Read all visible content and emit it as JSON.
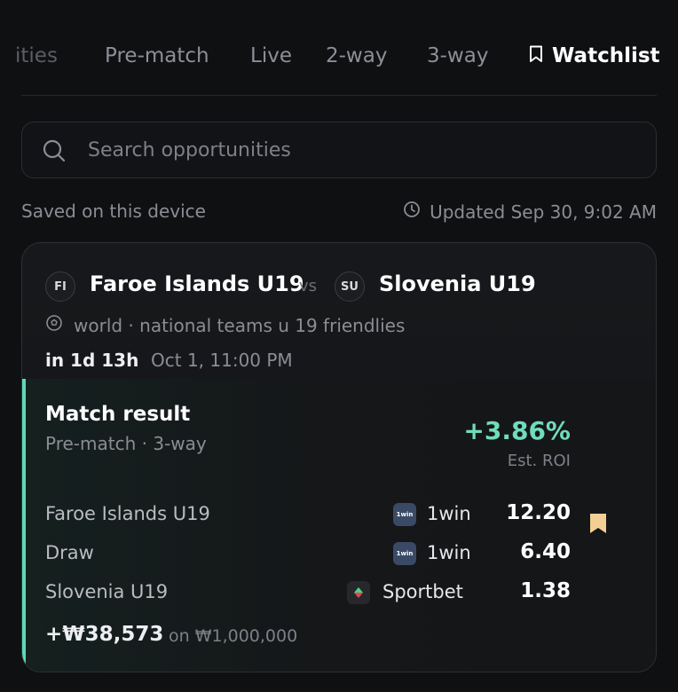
{
  "tabs": {
    "items": [
      {
        "label": "ities"
      },
      {
        "label": "Pre-match"
      },
      {
        "label": "Live"
      },
      {
        "label": "2-way"
      },
      {
        "label": "3-way"
      },
      {
        "label": "Watchlist",
        "icon": "bookmark-icon",
        "active": true
      }
    ]
  },
  "search": {
    "placeholder": "Search opportunities",
    "value": ""
  },
  "meta": {
    "saved_label": "Saved on this device",
    "updated_label": "Updated Sep 30, 9:02 AM"
  },
  "match": {
    "home": {
      "abbr": "FI",
      "name": "Faroe Islands U19"
    },
    "vs": "vs",
    "away": {
      "abbr": "SU",
      "name": "Slovenia U19"
    },
    "league": "world · national teams u 19 friendlies",
    "countdown": "in 1d 13h",
    "kickoff": "Oct 1, 11:00 PM",
    "market": {
      "title": "Match result",
      "subtitle": "Pre-match · 3-way",
      "roi": "+3.86%",
      "roi_label": "Est. ROI",
      "lines": [
        {
          "outcome": "Faroe Islands U19",
          "bookmaker": "1win",
          "logo_text": "1win",
          "odds": "12.20"
        },
        {
          "outcome": "Draw",
          "bookmaker": "1win",
          "logo_text": "1win",
          "odds": "6.40"
        },
        {
          "outcome": "Slovenia U19",
          "bookmaker": "Sportbet",
          "logo_text": "",
          "odds": "1.38"
        }
      ],
      "profit": "+₩38,573",
      "stake": "on ₩1,000,000"
    }
  },
  "colors": {
    "accent": "#6fdcbc",
    "bookmark": "#f3cf95",
    "background": "#0f1012"
  }
}
